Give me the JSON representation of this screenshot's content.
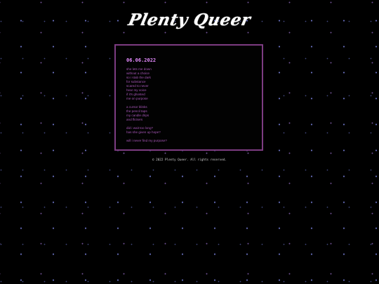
{
  "header": {
    "logo_text": "Plenty Queer"
  },
  "post": {
    "date": "06.06.2022",
    "stanzas": [
      [
        "she lets me down",
        "without a choice",
        "so i stab the dark",
        "for substance",
        "scared to never",
        "hear my voice",
        "if it's ghosted",
        "me on purpose"
      ],
      [
        "a cursor blinks",
        "the pencil taps",
        "my candle drips",
        "and flickers"
      ],
      [
        "did i wait too long?",
        "has she given up hope?"
      ],
      [
        "will i never find my purpose?"
      ]
    ]
  },
  "footer": {
    "text": "© 2022 Plenty Queer. All rights reserved."
  },
  "colors": {
    "background": "#000000",
    "panel_border": "#7d3c82",
    "date": "#e58bff",
    "poem_text": "#a857b8",
    "footer_text": "#cfcfcf"
  }
}
